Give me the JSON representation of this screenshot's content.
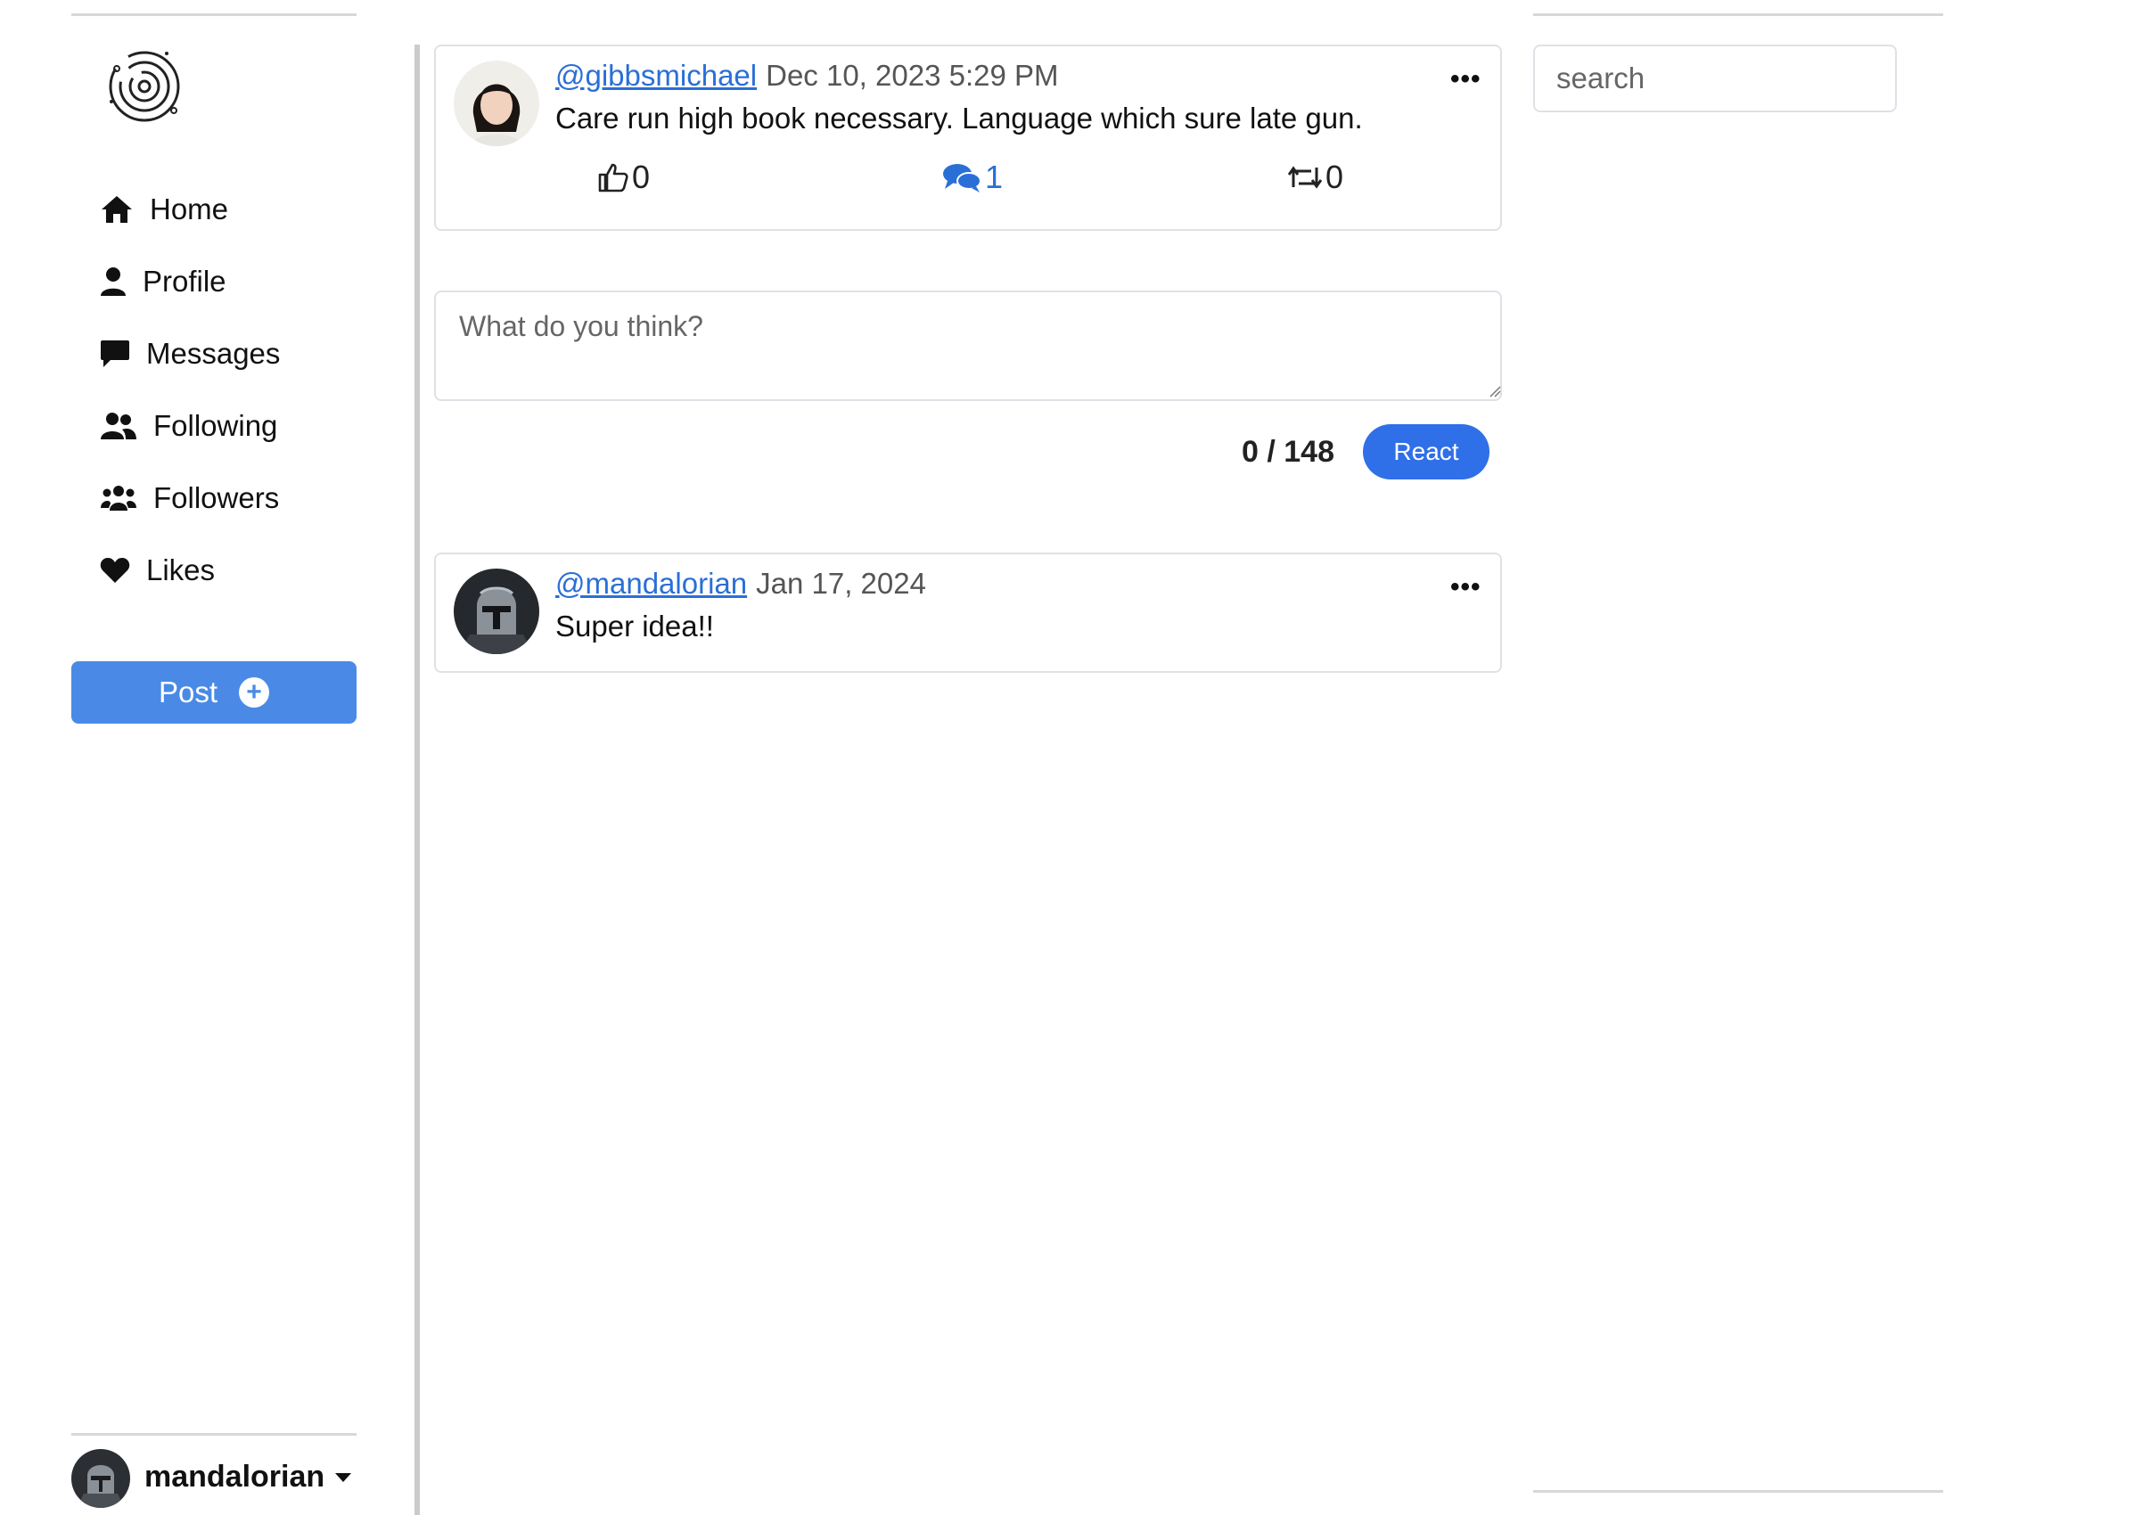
{
  "sidebar": {
    "items": [
      {
        "label": "Home",
        "icon": "home-icon"
      },
      {
        "label": "Profile",
        "icon": "person-icon"
      },
      {
        "label": "Messages",
        "icon": "message-icon"
      },
      {
        "label": "Following",
        "icon": "following-icon"
      },
      {
        "label": "Followers",
        "icon": "followers-icon"
      },
      {
        "label": "Likes",
        "icon": "heart-icon"
      }
    ],
    "post_label": "Post",
    "user": {
      "name": "mandalorian"
    }
  },
  "post": {
    "handle": "@gibbsmichael",
    "date": "Dec 10, 2023 5:29 PM",
    "text": "Care run high book necessary. Language which sure late gun.",
    "likes": "0",
    "comments": "1",
    "reposts": "0"
  },
  "composer": {
    "placeholder": "What do you think?",
    "counter": "0 / 148",
    "submit_label": "React"
  },
  "reply": {
    "handle": "@mandalorian",
    "date": "Jan 17, 2024",
    "text": "Super idea!!"
  },
  "search": {
    "placeholder": "search"
  },
  "colors": {
    "accent": "#4a8ae6",
    "react": "#2f6fe8",
    "link": "#2a6fd6"
  }
}
